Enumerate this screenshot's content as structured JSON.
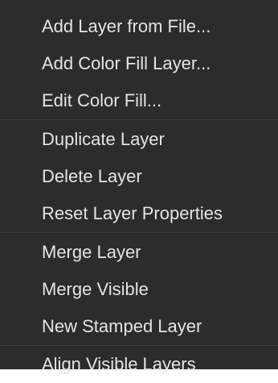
{
  "menu": {
    "groups": [
      {
        "items": [
          {
            "label": "Add Layer from File..."
          },
          {
            "label": "Add Color Fill Layer..."
          },
          {
            "label": "Edit Color Fill..."
          }
        ]
      },
      {
        "items": [
          {
            "label": "Duplicate Layer"
          },
          {
            "label": "Delete Layer"
          },
          {
            "label": "Reset Layer Properties"
          }
        ]
      },
      {
        "items": [
          {
            "label": "Merge Layer"
          },
          {
            "label": "Merge Visible"
          },
          {
            "label": "New Stamped Layer"
          }
        ]
      },
      {
        "items": [
          {
            "label": "Align Visible Layers"
          }
        ]
      }
    ]
  },
  "colors": {
    "background": "#2c2c2c",
    "text": "#e4e4e4",
    "separator": "#3f3f3f"
  }
}
